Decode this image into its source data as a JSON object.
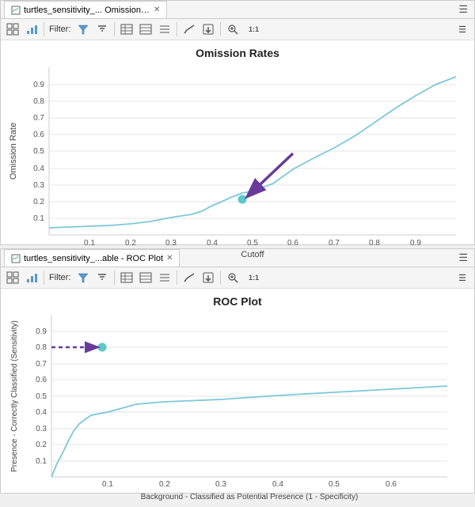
{
  "top_panel": {
    "tab_label": "turtles_sensitivity_... Omission Rates",
    "title": "Omission Rates",
    "x_axis_label": "Cutoff",
    "y_axis_label": "Omission Rate",
    "filter_label": "Filter:",
    "toolbar_buttons": [
      "grid-icon",
      "chart-icon",
      "filter-icon",
      "funnel-icon",
      "table-icon",
      "table2-icon",
      "table3-icon",
      "line-icon",
      "export-icon",
      "zoom-icon",
      "zoom-out-icon",
      "fit-icon",
      "menu-icon"
    ],
    "y_ticks": [
      "0.1",
      "0.2",
      "0.3",
      "0.4",
      "0.5",
      "0.6",
      "0.7",
      "0.8",
      "0.9"
    ],
    "x_ticks": [
      "0.1",
      "0.2",
      "0.3",
      "0.4",
      "0.5",
      "0.6",
      "0.7",
      "0.8",
      "0.9"
    ]
  },
  "bottom_panel": {
    "tab_label": "turtles_sensitivity_...able - ROC Plot",
    "title": "ROC Plot",
    "x_axis_label": "Background - Classified as Potential Presence (1 - Specificity)",
    "y_axis_label": "Presence - Correctly Classified (Sensitivity)",
    "filter_label": "Filter:",
    "y_ticks": [
      "0.1",
      "0.2",
      "0.3",
      "0.4",
      "0.5",
      "0.6",
      "0.7",
      "0.8",
      "0.9"
    ],
    "x_ticks": [
      "0.1",
      "0.2",
      "0.3",
      "0.4",
      "0.5",
      "0.6"
    ]
  }
}
